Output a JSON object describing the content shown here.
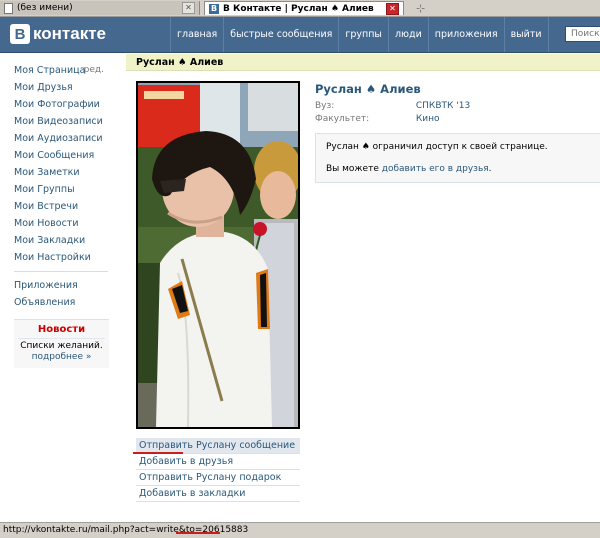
{
  "browser": {
    "tabs": [
      {
        "label": "(без имени)"
      },
      {
        "label": "В Контакте | Руслан ♠ Алиев"
      }
    ],
    "status_text": "http://vkontakte.ru/mail.php?act=write&to=20615883"
  },
  "header": {
    "logo_letter": "В",
    "logo_text": "контакте",
    "nav": [
      "главная",
      "быстрые сообщения",
      "группы",
      "люди",
      "приложения",
      "выйти"
    ],
    "search_placeholder": "Поиск"
  },
  "left_menu": {
    "items": [
      "Моя Страница",
      "Мои Друзья",
      "Мои Фотографии",
      "Мои Видеозаписи",
      "Мои Аудиозаписи",
      "Мои Сообщения",
      "Мои Заметки",
      "Мои Группы",
      "Мои Встречи",
      "Мои Новости",
      "Мои Закладки",
      "Мои Настройки"
    ],
    "edit_label": "ред.",
    "extra_items": [
      "Приложения",
      "Объявления"
    ],
    "news": {
      "title": "Новости",
      "text": "Списки желаний.",
      "more": "подробнее »"
    }
  },
  "profile": {
    "title_bar": "Руслан ♠ Алиев",
    "name": "Руслан ♠ Алиев",
    "fields": [
      {
        "label": "Вуз:",
        "value": "СПКВТК '13"
      },
      {
        "label": "Факультет:",
        "value": "Кино"
      }
    ],
    "notice_line": "Руслан ♠ ограничил доступ к своей странице.",
    "notice_prefix": "Вы можете",
    "notice_link": "добавить его в друзья",
    "notice_suffix": ".",
    "actions": [
      "Отправить Руслану сообщение",
      "Добавить в друзья",
      "Отправить Руслану подарок",
      "Добавить в закладки"
    ]
  }
}
